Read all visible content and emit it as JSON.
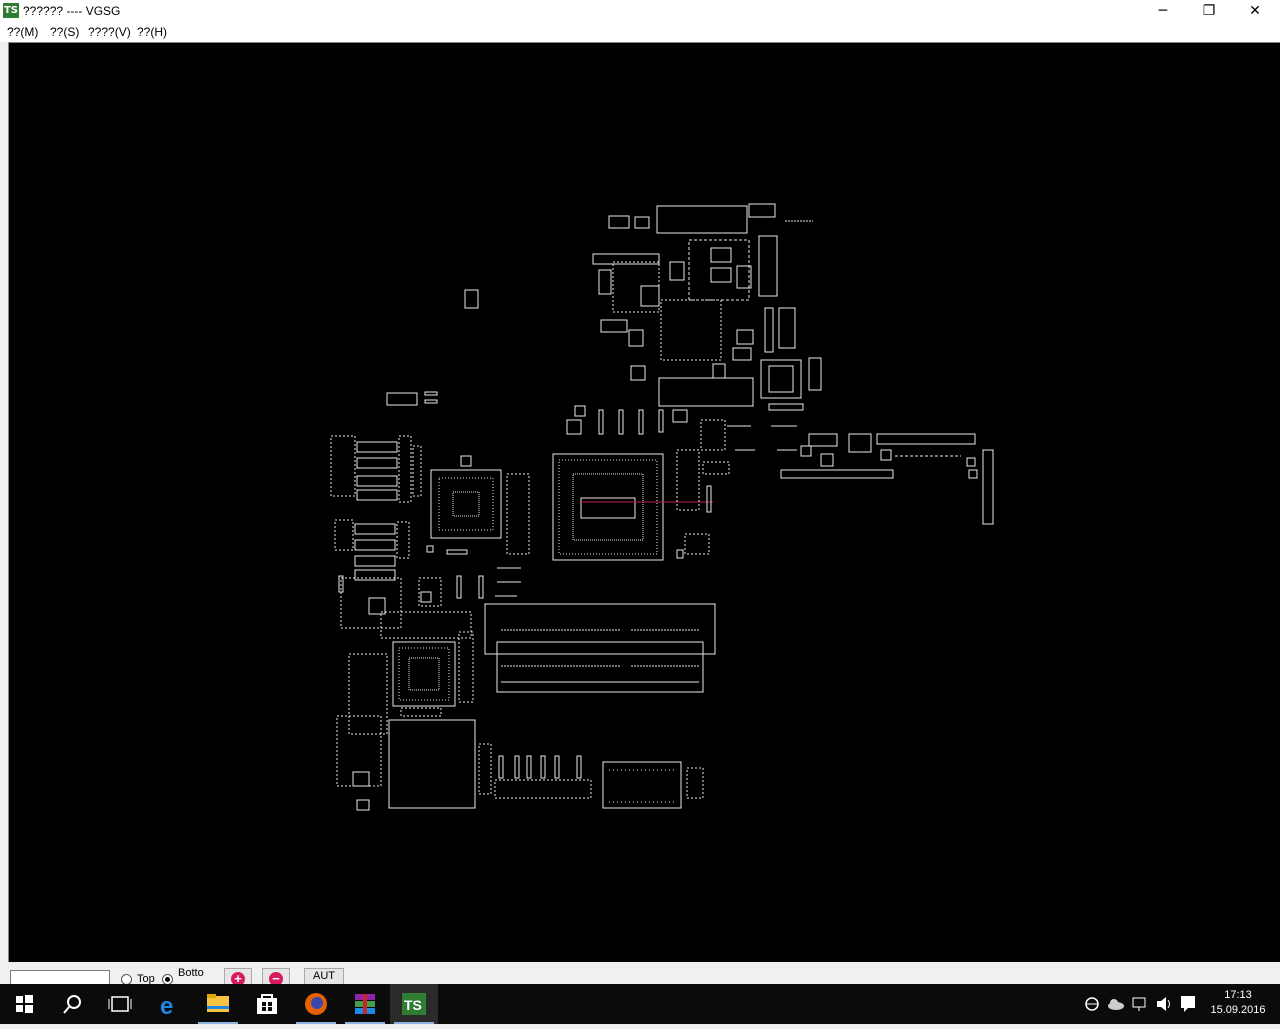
{
  "window": {
    "title": "?????? ---- VGSG",
    "logo_text": "TS",
    "minimize": "─",
    "restore": "❐",
    "close": "✕"
  },
  "menu": [
    {
      "label": "??(M)"
    },
    {
      "label": "??(S)"
    },
    {
      "label": "????(V)"
    },
    {
      "label": "??(H)"
    }
  ],
  "statusbar": {
    "search_value": "",
    "radio_top": "Top",
    "radio_bottom": "Botto",
    "selected_side": "Botto",
    "auto_button": "AUT"
  },
  "taskbar": {
    "icons": [
      "windows-start-icon",
      "search-icon",
      "task-view-icon",
      "edge-browser-icon",
      "file-explorer-icon",
      "store-icon",
      "firefox-icon",
      "winrar-icon",
      "ts-boardview-icon"
    ],
    "active": "ts-boardview-icon",
    "time": "17:13",
    "date": "15.09.2016"
  },
  "colors": {
    "canvas": "#000000",
    "outline": "#e8e8e8",
    "highlight": "#c2185b",
    "logo": "#2e7d32"
  }
}
